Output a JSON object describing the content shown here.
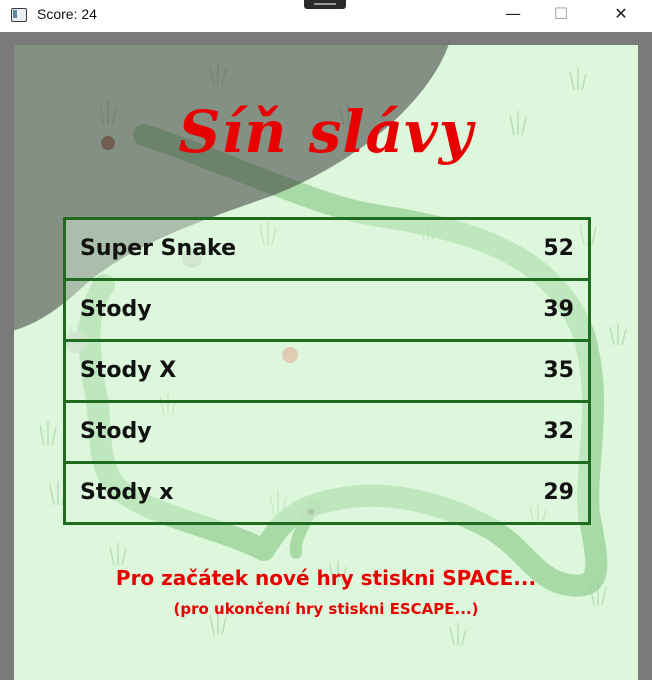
{
  "window": {
    "title": "Score: 24",
    "minimize_glyph": "—",
    "maximize_glyph": "☐",
    "close_glyph": "✕"
  },
  "hall_of_fame": {
    "heading": "Síň slávy",
    "entries": [
      {
        "name": "Super Snake",
        "score": "52"
      },
      {
        "name": "Stody",
        "score": "39"
      },
      {
        "name": "Stody X",
        "score": "35"
      },
      {
        "name": "Stody",
        "score": "32"
      },
      {
        "name": "Stody x",
        "score": "29"
      }
    ]
  },
  "instructions": {
    "start": "Pro začátek nové hry stiskni SPACE...",
    "quit": "(pro ukončení hry stiskni ESCAPE...)"
  },
  "colors": {
    "heading": "#e80000",
    "table_border": "#1f6b1f",
    "field": "#dcf7dc",
    "snake": "#9ed59a"
  }
}
